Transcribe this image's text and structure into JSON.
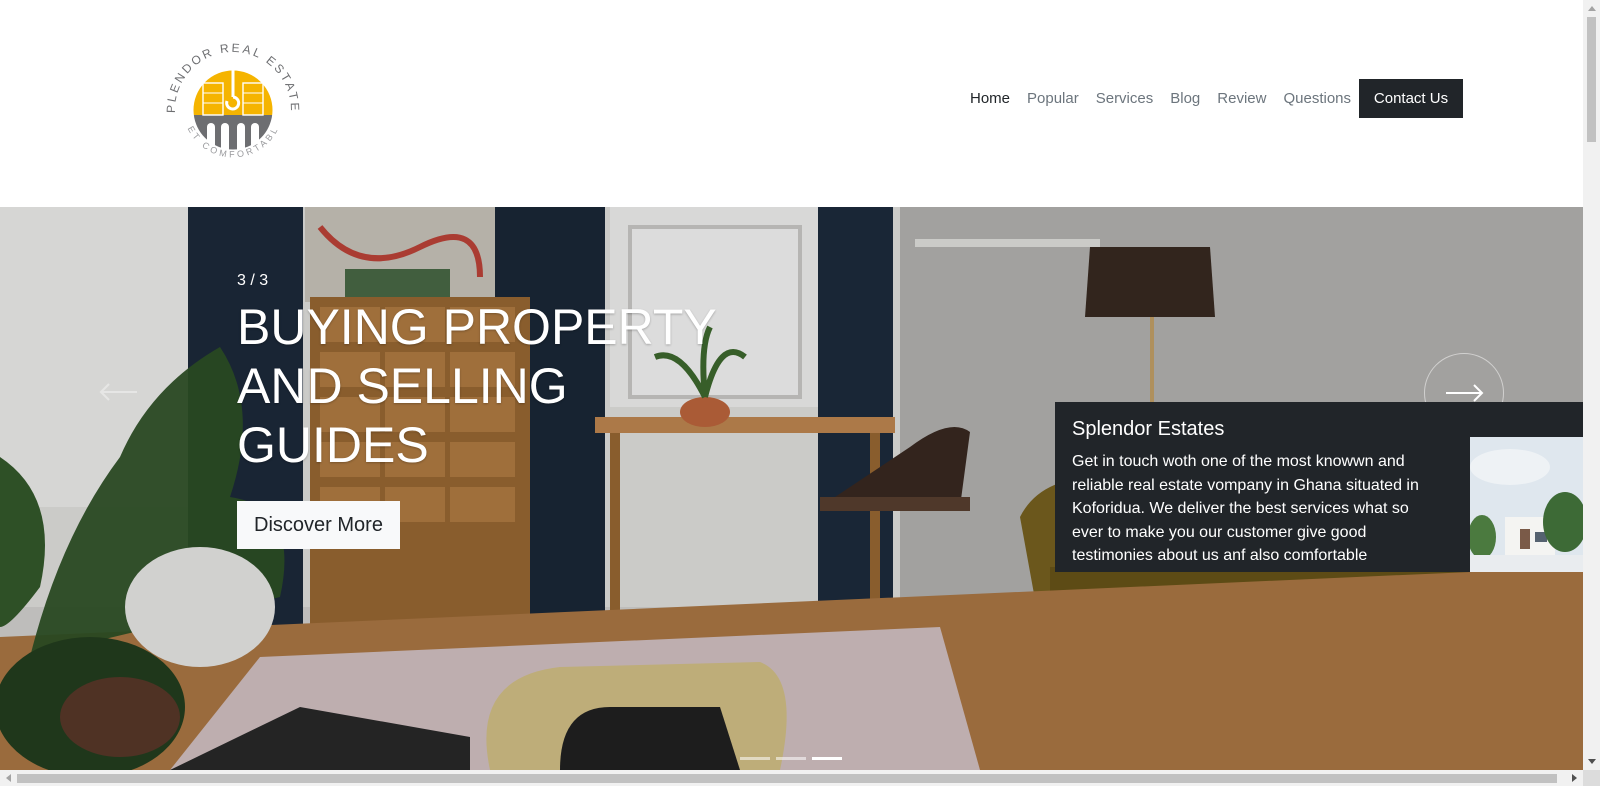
{
  "brand": {
    "name": "SPLENDOR REAL ESTATES",
    "tagline": "GET COMFORTABLE",
    "colors": {
      "yellow": "#f5b400",
      "gray": "#6d6e71"
    }
  },
  "nav": {
    "items": [
      {
        "label": "Home",
        "active": true
      },
      {
        "label": "Popular"
      },
      {
        "label": "Services"
      },
      {
        "label": "Blog"
      },
      {
        "label": "Review"
      },
      {
        "label": "Questions"
      }
    ],
    "contact_label": "Contact Us"
  },
  "hero": {
    "counter": "3 / 3",
    "title": "BUYING PROPERTY AND SELLING GUIDES",
    "cta_label": "Discover More",
    "prev_icon": "arrow-left-icon",
    "next_icon": "arrow-right-icon",
    "slides_total": 3,
    "active_slide": 3
  },
  "info_card": {
    "title": "Splendor Estates",
    "text": "Get in touch woth one of the most knowwn and reliable real estate vompany in Ghana situated in Koforidua. We deliver the best services what so ever to make you our customer give good testimonies about us anf also comfortable"
  },
  "colors": {
    "dark": "#212529",
    "muted": "#6c757d",
    "light": "#f8f9fa"
  }
}
